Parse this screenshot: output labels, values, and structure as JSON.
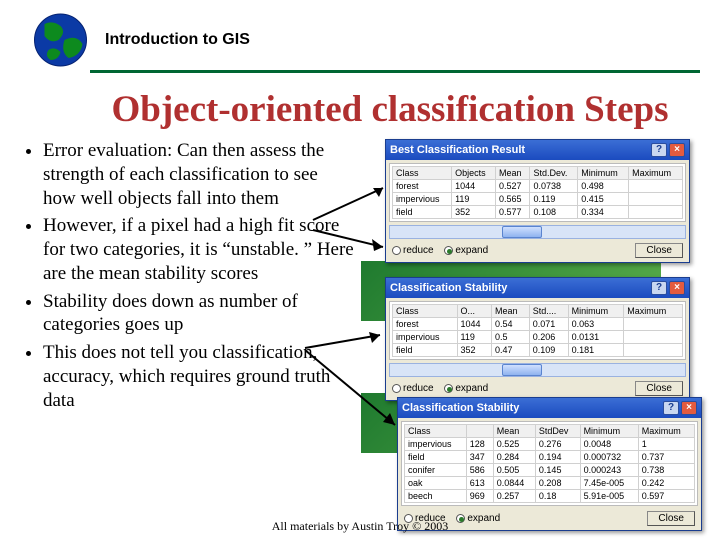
{
  "header": {
    "course": "Introduction to GIS"
  },
  "title": "Object-oriented classification Steps",
  "bullets": [
    "Error evaluation: Can then assess the strength of each classification to see how well objects fall into them",
    "However, if a pixel had a high fit score for two categories, it is “unstable. ” Here are the mean stability scores",
    "Stability does down as number of categories goes up",
    "This does not tell you classification, accuracy, which requires ground truth data"
  ],
  "windows": {
    "w1": {
      "title": "Best Classification Result",
      "cols": [
        "Class",
        "Objects",
        "Mean",
        "Std.Dev.",
        "Minimum",
        "Maximum"
      ],
      "rows": [
        [
          "forest",
          "1044",
          "0.527",
          "0.0738",
          "0.498",
          ""
        ],
        [
          "impervious",
          "119",
          "0.565",
          "0.119",
          "0.415",
          ""
        ],
        [
          "field",
          "352",
          "0.577",
          "0.108",
          "0.334",
          ""
        ]
      ],
      "r1": "reduce",
      "r2": "expand",
      "close": "Close"
    },
    "w2": {
      "title": "Classification Stability",
      "cols": [
        "Class",
        "O...",
        "Mean",
        "Std....",
        "Minimum",
        "Maximum"
      ],
      "rows": [
        [
          "forest",
          "1044",
          "0.54",
          "0.071",
          "0.063",
          ""
        ],
        [
          "impervious",
          "119",
          "0.5",
          "0.206",
          "0.0131",
          ""
        ],
        [
          "field",
          "352",
          "0.47",
          "0.109",
          "0.181",
          ""
        ]
      ],
      "r1": "reduce",
      "r2": "expand",
      "close": "Close"
    },
    "w3": {
      "title": "Classification Stability",
      "cols": [
        "Class",
        "",
        "Mean",
        "StdDev",
        "Minimum",
        "Maximum"
      ],
      "rows": [
        [
          "impervious",
          "128",
          "0.525",
          "0.276",
          "0.0048",
          "1"
        ],
        [
          "field",
          "347",
          "0.284",
          "0.194",
          "0.000732",
          "0.737"
        ],
        [
          "conifer",
          "586",
          "0.505",
          "0.145",
          "0.000243",
          "0.738"
        ],
        [
          "oak",
          "613",
          "0.0844",
          "0.208",
          "7.45e-005",
          "0.242"
        ],
        [
          "beech",
          "969",
          "0.257",
          "0.18",
          "5.91e-005",
          "0.597"
        ]
      ],
      "r1": "reduce",
      "r2": "expand",
      "close": "Close"
    }
  },
  "footer": "All materials by Austin Troy © 2003"
}
